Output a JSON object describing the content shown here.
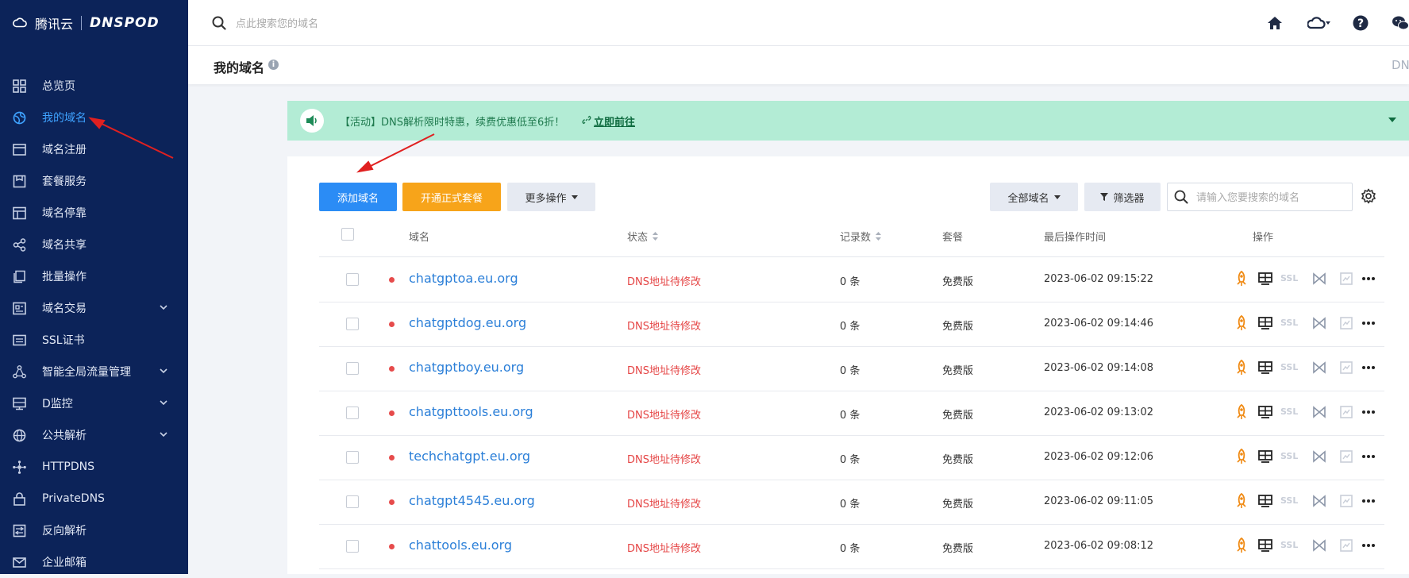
{
  "brand": {
    "cloud_name": "腾讯云",
    "product": "DNSPOD"
  },
  "sidebar": {
    "items": [
      {
        "label": "总览页",
        "icon": "dashboard-icon",
        "active": false,
        "expandable": false
      },
      {
        "label": "我的域名",
        "icon": "globe-icon",
        "active": true,
        "expandable": false
      },
      {
        "label": "域名注册",
        "icon": "register-icon",
        "active": false,
        "expandable": false
      },
      {
        "label": "套餐服务",
        "icon": "package-icon",
        "active": false,
        "expandable": false
      },
      {
        "label": "域名停靠",
        "icon": "parking-icon",
        "active": false,
        "expandable": false
      },
      {
        "label": "域名共享",
        "icon": "share-icon",
        "active": false,
        "expandable": false
      },
      {
        "label": "批量操作",
        "icon": "batch-icon",
        "active": false,
        "expandable": false
      },
      {
        "label": "域名交易",
        "icon": "trade-icon",
        "active": false,
        "expandable": true
      },
      {
        "label": "SSL证书",
        "icon": "ssl-icon",
        "active": false,
        "expandable": false
      },
      {
        "label": "智能全局流量管理",
        "icon": "traffic-icon",
        "active": false,
        "expandable": true
      },
      {
        "label": "D监控",
        "icon": "monitor-icon",
        "active": false,
        "expandable": true
      },
      {
        "label": "公共解析",
        "icon": "public-dns-icon",
        "active": false,
        "expandable": true
      },
      {
        "label": "HTTPDNS",
        "icon": "httpdns-icon",
        "active": false,
        "expandable": false
      },
      {
        "label": "PrivateDNS",
        "icon": "private-dns-icon",
        "active": false,
        "expandable": false
      },
      {
        "label": "反向解析",
        "icon": "reverse-icon",
        "active": false,
        "expandable": false
      },
      {
        "label": "企业邮箱",
        "icon": "mail-icon",
        "active": false,
        "expandable": false
      }
    ]
  },
  "topbar": {
    "search_placeholder": "点此搜索您的域名"
  },
  "page": {
    "title": "我的域名",
    "right_tag": "DN"
  },
  "banner": {
    "text": "【活动】DNS解析限时特惠，续费优惠低至6折！",
    "link_label": "立即前往"
  },
  "toolbar": {
    "add_domain": "添加域名",
    "open_plan": "开通正式套餐",
    "more_actions": "更多操作",
    "all_domains": "全部域名",
    "filter": "筛选器",
    "search_placeholder": "请输入您要搜索的域名"
  },
  "table": {
    "headers": {
      "domain": "域名",
      "status": "状态",
      "records": "记录数",
      "plan": "套餐",
      "last_op": "最后操作时间",
      "actions": "操作"
    },
    "rows": [
      {
        "domain": "chatgptoa.eu.org",
        "status": "DNS地址待修改",
        "records": "0 条",
        "plan": "免费版",
        "time": "2023-06-02 09:15:22"
      },
      {
        "domain": "chatgptdog.eu.org",
        "status": "DNS地址待修改",
        "records": "0 条",
        "plan": "免费版",
        "time": "2023-06-02 09:14:46"
      },
      {
        "domain": "chatgptboy.eu.org",
        "status": "DNS地址待修改",
        "records": "0 条",
        "plan": "免费版",
        "time": "2023-06-02 09:14:08"
      },
      {
        "domain": "chatgpttools.eu.org",
        "status": "DNS地址待修改",
        "records": "0 条",
        "plan": "免费版",
        "time": "2023-06-02 09:13:02"
      },
      {
        "domain": "techchatgpt.eu.org",
        "status": "DNS地址待修改",
        "records": "0 条",
        "plan": "免费版",
        "time": "2023-06-02 09:12:06"
      },
      {
        "domain": "chatgpt4545.eu.org",
        "status": "DNS地址待修改",
        "records": "0 条",
        "plan": "免费版",
        "time": "2023-06-02 09:11:05"
      },
      {
        "domain": "chattools.eu.org",
        "status": "DNS地址待修改",
        "records": "0 条",
        "plan": "免费版",
        "time": "2023-06-02 09:08:12"
      }
    ],
    "op_ssl_label": "SSL"
  },
  "colors": {
    "sidebar_bg": "#0c2359",
    "primary": "#2b8cf5",
    "orange": "#f7a41a",
    "banner_bg": "#b3ecd5",
    "status_red": "#e54545",
    "link_blue": "#2b7fd8",
    "annotation_red": "#e02020"
  }
}
